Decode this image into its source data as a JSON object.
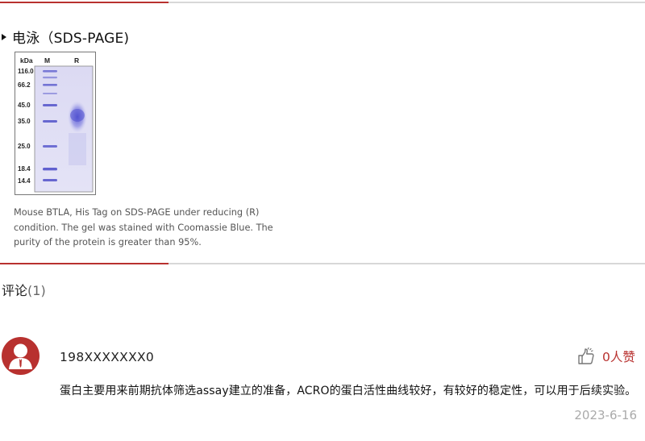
{
  "section": {
    "title": "电泳（SDS-PAGE)"
  },
  "gel": {
    "unit_label": "kDa",
    "lanes": [
      "M",
      "R"
    ],
    "markers": [
      "116.0",
      "66.2",
      "45.0",
      "35.0",
      "25.0",
      "18.4",
      "14.4"
    ],
    "colors": {
      "band": "#6a6ad8",
      "gel_bg": "#e7e6f6"
    }
  },
  "caption": "Mouse BTLA, His Tag on SDS-PAGE under reducing (R) condition. The gel was stained with Coomassie Blue. The purity of the protein is greater than 95%.",
  "comments": {
    "label": "评论",
    "count": "(1)",
    "items": [
      {
        "username": "198XXXXXXX0",
        "likes": "0人赞",
        "text": "蛋白主要用来前期抗体筛选assay建立的准备，ACRO的蛋白活性曲线较好，有较好的稳定性，可以用于后续实验。",
        "date": "2023-6-16",
        "avatar_icon": "user-avatar-icon",
        "like_icon": "thumbs-up-icon"
      }
    ]
  },
  "colors": {
    "accent": "#b8312f",
    "divider": "#d8d8d8"
  }
}
